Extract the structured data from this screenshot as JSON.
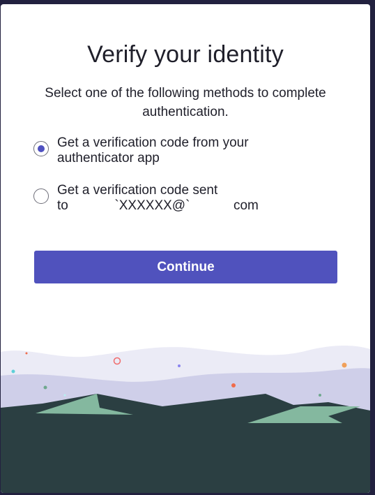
{
  "dialog": {
    "title": "Verify your identity",
    "instruction": "Select one of the following methods to complete authentication.",
    "options": [
      {
        "line1": "Get a verification code from your",
        "line2": "authenticator app",
        "selected": true
      },
      {
        "line1": "Get a verification code sent",
        "line2_prefix": "to",
        "line2_email": "`XXXXXX@`",
        "line2_suffix": "com",
        "selected": false
      }
    ],
    "continue_label": "Continue"
  },
  "colors": {
    "accent": "#5052bd",
    "background": "#22213f",
    "mountain": "#2b3f42",
    "mountain_highlight": "#84b89f",
    "wave": "#cfcfe9"
  }
}
